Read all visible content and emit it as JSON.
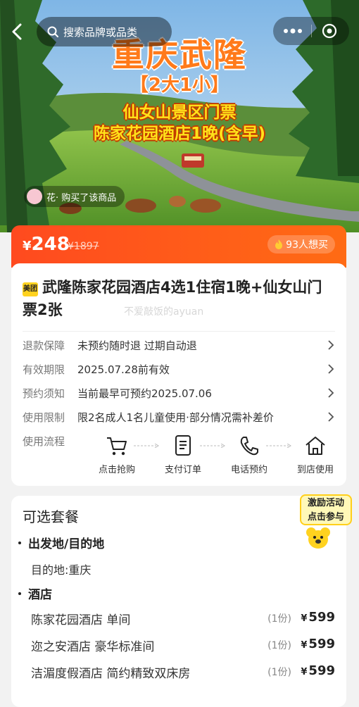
{
  "search": {
    "placeholder": "搜索品牌或品类"
  },
  "hero": {
    "line1": "重庆武隆",
    "line2": "【2大1小】",
    "line3": "仙女山景区门票",
    "line4": "陈家花园酒店1晚(含早)",
    "buyer_text": "花· 购买了该商品"
  },
  "price": {
    "currency": "¥",
    "value": "248",
    "original": "¥1897",
    "want_count": "93人想买"
  },
  "product": {
    "brand_badge": "美团",
    "title": "武隆陈家花园酒店4选1住宿1晚+仙女山门票2张",
    "watermark": "不爱敲饭的ayuan",
    "rows": [
      {
        "label": "退款保障",
        "value": "未预约随时退 过期自动退"
      },
      {
        "label": "有效期限",
        "value": "2025.07.28前有效"
      },
      {
        "label": "预约须知",
        "value": "当前最早可预约2025.07.06"
      },
      {
        "label": "使用限制",
        "value": "限2名成人1名儿童使用·部分情况需补差价"
      }
    ],
    "flow_label": "使用流程",
    "flow_steps": [
      {
        "label": "点击抢购",
        "icon": "cart-icon"
      },
      {
        "label": "支付订单",
        "icon": "order-icon"
      },
      {
        "label": "电话预约",
        "icon": "phone-icon"
      },
      {
        "label": "到店使用",
        "icon": "home-icon"
      }
    ]
  },
  "packages": {
    "title": "可选套餐",
    "section_origin": "出发地/目的地",
    "destination": "目的地:重庆",
    "section_hotel": "酒店",
    "options": [
      {
        "name": "陈家花园酒店 单间",
        "qty": "(1份)",
        "currency": "¥",
        "price": "599"
      },
      {
        "name": "迩之安酒店 豪华标准间",
        "qty": "(1份)",
        "currency": "¥",
        "price": "599"
      },
      {
        "name": "洁湄度假酒店 简约精致双床房",
        "qty": "(1份)",
        "currency": "¥",
        "price": "599"
      }
    ]
  },
  "promo": {
    "line1": "激励活动",
    "line2": "点击参与"
  },
  "colors": {
    "accent": "#ff4a1f",
    "accent2": "#ff6b14",
    "hero_orange": "#ff7a1a",
    "hero_yellow": "#ffe21a"
  }
}
